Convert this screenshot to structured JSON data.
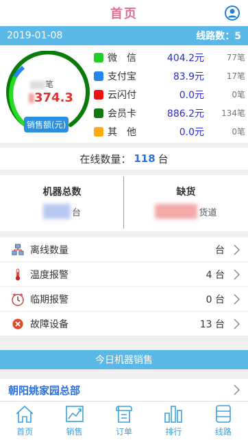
{
  "header": {
    "title": "首页"
  },
  "datebar": {
    "date": "2019-01-08",
    "routes_label": "线路数：5"
  },
  "sales": {
    "count_suffix": "笔",
    "amount_visible": "374.3",
    "gauge_label": "销售额(元)",
    "payments": [
      {
        "name": "微　信",
        "amount": "404.2元",
        "count": "77笔",
        "color": "#22cc22"
      },
      {
        "name": "支付宝",
        "amount": "83.9元",
        "count": "17笔",
        "color": "#2288ee"
      },
      {
        "name": "云闪付",
        "amount": "0.0元",
        "count": "0笔",
        "color": "#ee1111"
      },
      {
        "name": "会员卡",
        "amount": "886.2元",
        "count": "134笔",
        "color": "#117711"
      },
      {
        "name": "其　他",
        "amount": "0.0元",
        "count": "0笔",
        "color": "#ffaa11"
      }
    ]
  },
  "online": {
    "prefix": "在线数量：",
    "value": "118",
    "suffix": "台"
  },
  "stats": {
    "machines": {
      "label": "机器总数",
      "unit": "台"
    },
    "shortage": {
      "label": "缺货",
      "unit": "货道"
    }
  },
  "alarms": [
    {
      "label": "离线数量",
      "value": "台",
      "icon": "network-icon"
    },
    {
      "label": "温度报警",
      "value": "4 台",
      "icon": "thermometer-icon"
    },
    {
      "label": "临期报警",
      "value": "0 台",
      "icon": "clock-icon"
    },
    {
      "label": "故障设备",
      "value": "13 台",
      "icon": "fault-icon"
    }
  ],
  "today": {
    "title": "今日机器销售",
    "branch": "朝阳姚家园总部"
  },
  "nav": [
    {
      "label": "首页",
      "icon": "home-icon"
    },
    {
      "label": "销售",
      "icon": "sales-chart-icon"
    },
    {
      "label": "订单",
      "icon": "order-icon"
    },
    {
      "label": "排行",
      "icon": "ranking-icon"
    },
    {
      "label": "线路",
      "icon": "route-icon"
    }
  ]
}
